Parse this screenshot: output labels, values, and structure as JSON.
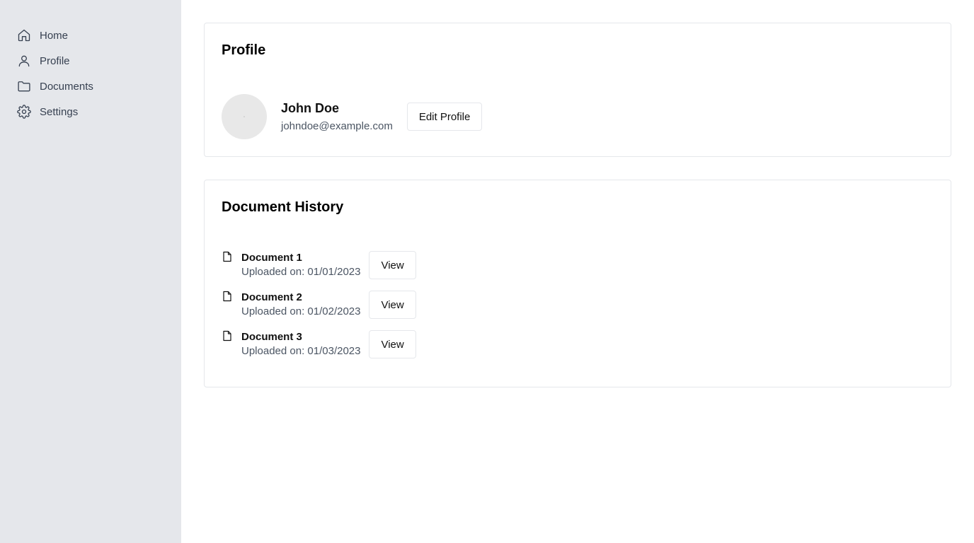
{
  "sidebar": {
    "items": [
      {
        "label": "Home",
        "icon": "home-icon"
      },
      {
        "label": "Profile",
        "icon": "user-icon"
      },
      {
        "label": "Documents",
        "icon": "folder-icon"
      },
      {
        "label": "Settings",
        "icon": "gear-icon"
      }
    ]
  },
  "profile": {
    "title": "Profile",
    "name": "John Doe",
    "email": "johndoe@example.com",
    "edit_label": "Edit Profile"
  },
  "documents": {
    "title": "Document History",
    "items": [
      {
        "name": "Document 1",
        "date": "Uploaded on: 01/01/2023",
        "action": "View"
      },
      {
        "name": "Document 2",
        "date": "Uploaded on: 01/02/2023",
        "action": "View"
      },
      {
        "name": "Document 3",
        "date": "Uploaded on: 01/03/2023",
        "action": "View"
      }
    ]
  },
  "colors": {
    "sidebar_bg": "#e5e7eb",
    "card_border": "#e5e7eb",
    "muted_text": "#4b5563"
  }
}
